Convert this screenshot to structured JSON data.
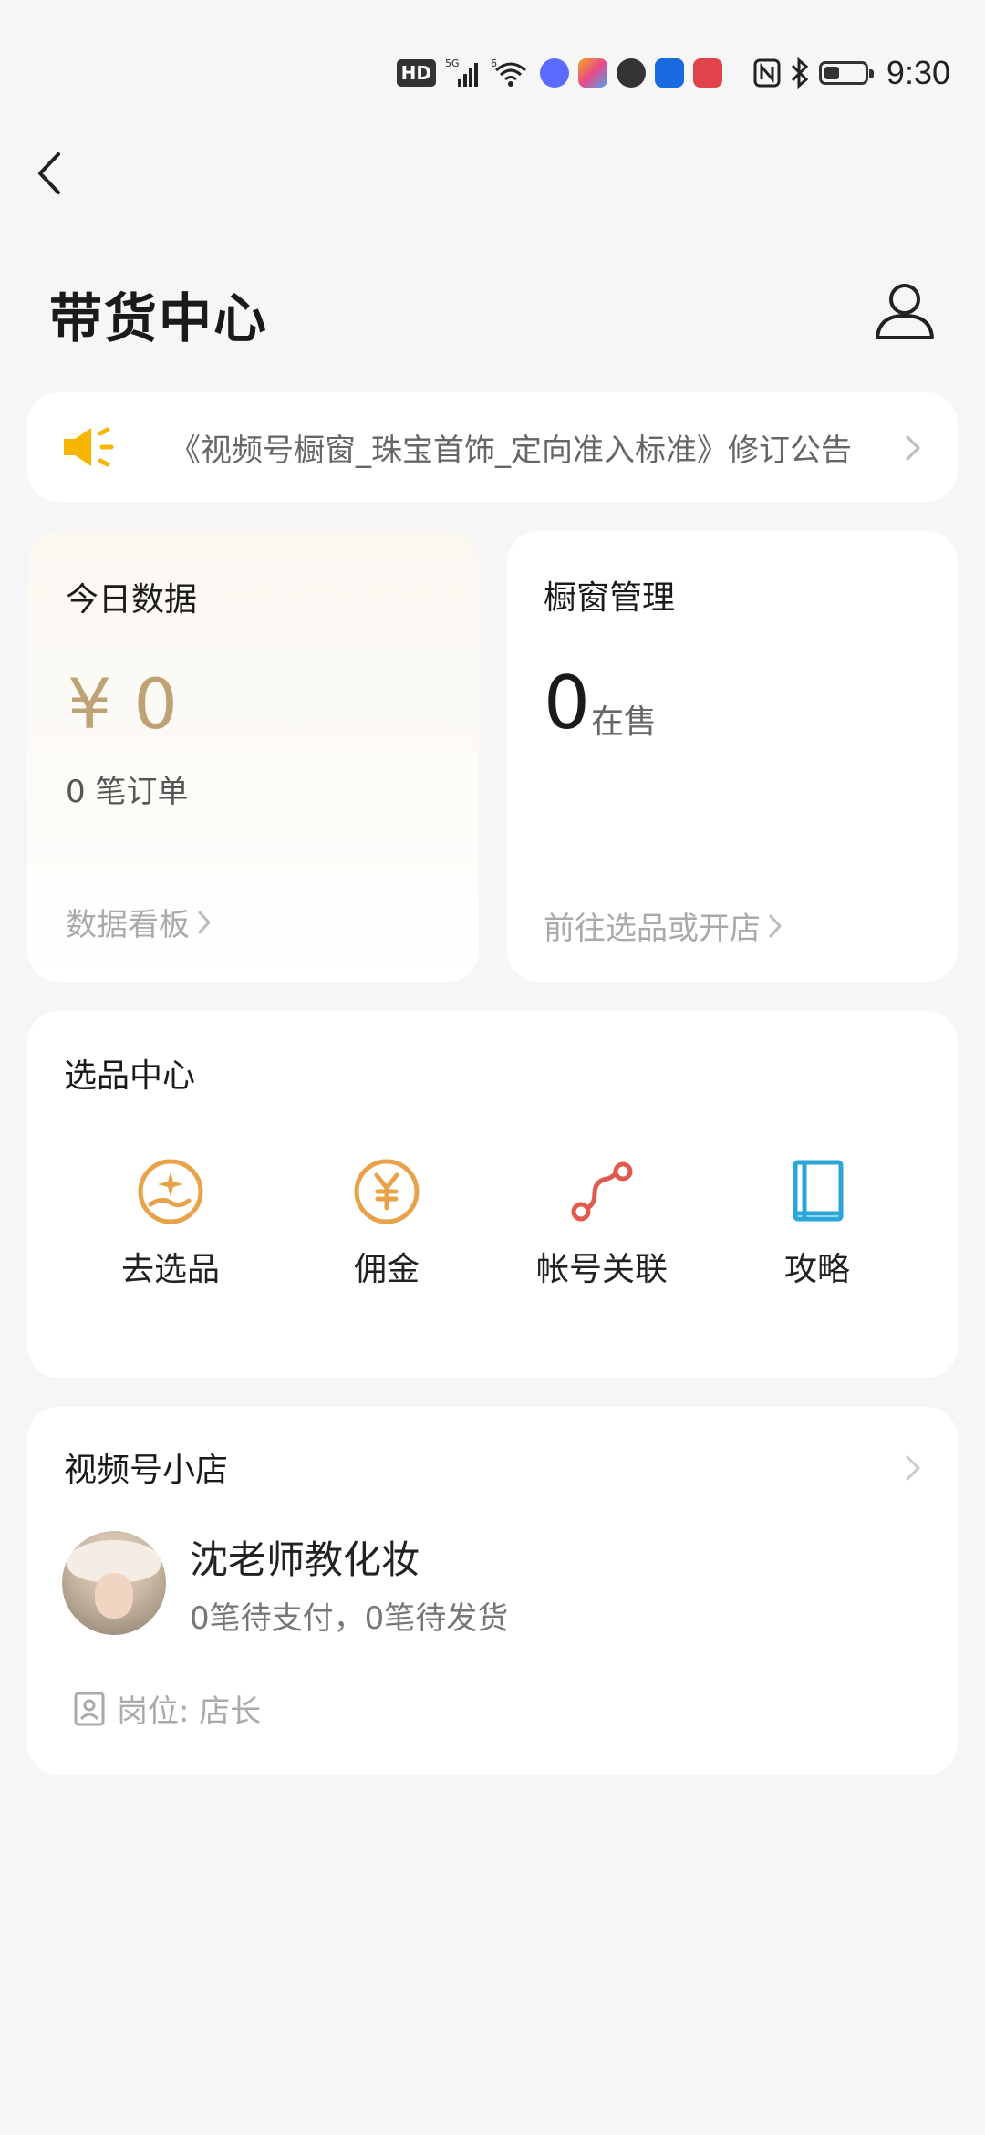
{
  "status_bar": {
    "hd": "HD",
    "time": "9:30",
    "app_colors": [
      "#5b6bff",
      "#f4a81f",
      "#333333",
      "#1b6be0",
      "#e0444a"
    ]
  },
  "header": {
    "title": "带货中心",
    "back_icon": "chevron-left-icon",
    "user_icon": "user-icon"
  },
  "notice": {
    "icon": "megaphone-icon",
    "text": "《视频号橱窗_珠宝首饰_定向准入标准》修订公告"
  },
  "today": {
    "title": "今日数据",
    "amount": "¥ 0",
    "orders": "0 笔订单",
    "link": "数据看板"
  },
  "showcase": {
    "title": "橱窗管理",
    "count": "0",
    "unit": "在售",
    "link": "前往选品或开店"
  },
  "select_center": {
    "title": "选品中心",
    "tools": [
      {
        "label": "去选品",
        "icon": "select-product-icon",
        "color": "#e8a24a"
      },
      {
        "label": "佣金",
        "icon": "commission-icon",
        "color": "#e8a24a"
      },
      {
        "label": "帐号关联",
        "icon": "account-link-icon",
        "color": "#e05a4e"
      },
      {
        "label": "攻略",
        "icon": "guide-book-icon",
        "color": "#2aa7d8"
      }
    ]
  },
  "shop": {
    "title": "视频号小店",
    "name": "沈老师教化妆",
    "status": "0笔待支付，0笔待发货",
    "role": "岗位: 店长"
  },
  "colors": {
    "accent_gold": "#bfa274",
    "notice_yellow": "#f7b500",
    "background": "#f6f6f6"
  }
}
